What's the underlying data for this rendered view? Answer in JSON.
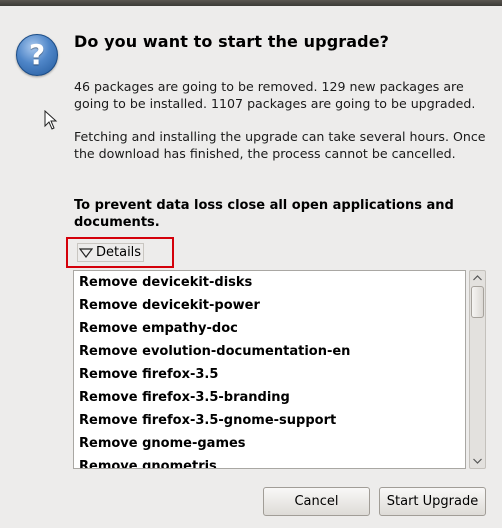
{
  "dialog": {
    "heading": "Do you want to start the upgrade?",
    "summary": "46 packages are going to be removed. 129 new packages are going to be installed. 1107 packages are going to be upgraded.",
    "notice": "Fetching and installing the upgrade can take several hours. Once the download has finished, the process cannot be cancelled.",
    "warning": "To prevent data loss close all open applications and documents.",
    "icon": "question-icon"
  },
  "details": {
    "label": "Details",
    "expanded": true,
    "items": [
      "Remove devicekit-disks",
      "Remove devicekit-power",
      "Remove empathy-doc",
      "Remove evolution-documentation-en",
      "Remove firefox-3.5",
      "Remove firefox-3.5-branding",
      "Remove firefox-3.5-gnome-support",
      "Remove gnome-games",
      "Remove gnometris"
    ]
  },
  "buttons": {
    "cancel": "Cancel",
    "start": "Start Upgrade"
  },
  "colors": {
    "highlight_border": "#d4000a",
    "window_bg": "#edeceb"
  }
}
